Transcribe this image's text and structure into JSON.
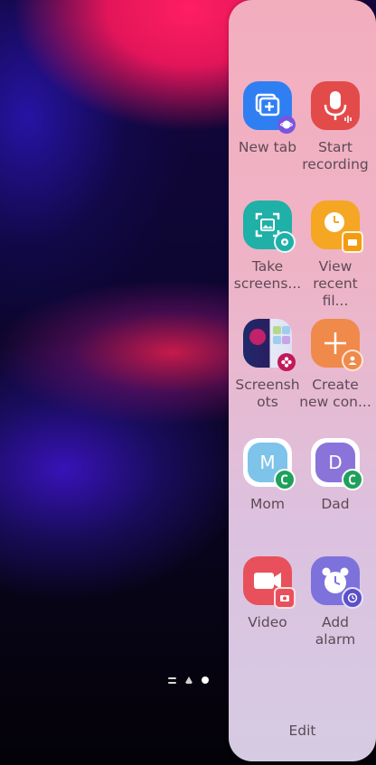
{
  "wallpaper": {
    "colors": [
      "#ff1e62",
      "#3a1ec8",
      "#0c0630"
    ]
  },
  "home_page_indicators": [
    "menu-indicator",
    "home-indicator",
    "current-page-dot"
  ],
  "edge_panel": {
    "apps": [
      {
        "label": "New tab",
        "icon": "new-tab-icon",
        "color": "#2f7ff2"
      },
      {
        "label": "Start\nrecording",
        "icon": "microphone-icon",
        "color": "#e24b49"
      },
      {
        "label": "Take\nscreens...",
        "icon": "screenshot-icon",
        "color": "#1fb0a8"
      },
      {
        "label": "View\nrecent fil...",
        "icon": "clock-icon",
        "color": "#f5a623"
      },
      {
        "label": "Screensh\nots",
        "icon": "gallery-icon",
        "color": "#c2185b"
      },
      {
        "label": "Create\nnew con...",
        "icon": "add-contact-icon",
        "color": "#f08a4b"
      },
      {
        "label": "Mom",
        "icon": "contact-avatar-icon",
        "avatar_letter": "M",
        "color": "#7ec3ea"
      },
      {
        "label": "Dad",
        "icon": "contact-avatar-icon",
        "avatar_letter": "D",
        "color": "#8a74d9"
      },
      {
        "label": "Video",
        "icon": "video-icon",
        "color": "#e8505b"
      },
      {
        "label": "Add\nalarm",
        "icon": "alarm-icon",
        "color": "#7d72dc"
      }
    ],
    "edit_label": "Edit"
  }
}
